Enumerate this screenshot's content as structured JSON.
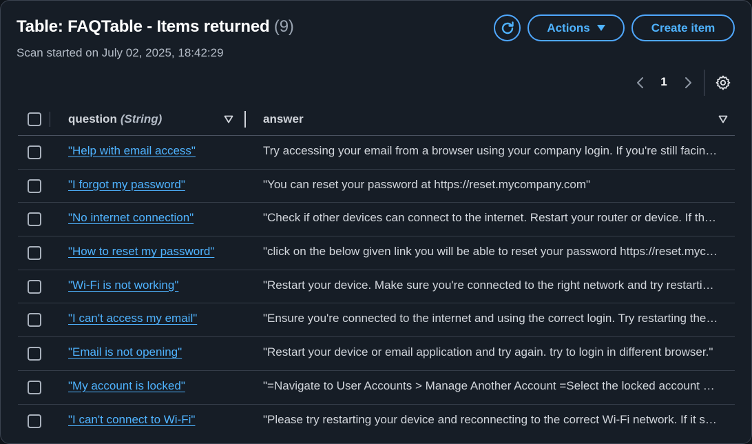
{
  "header": {
    "title_main": "Table: FAQTable - Items returned",
    "title_count": "(9)",
    "subtitle": "Scan started on July 02, 2025, 18:42:29",
    "refresh_icon": "refresh-icon",
    "actions_label": "Actions",
    "create_label": "Create item"
  },
  "pagination": {
    "current_page": "1",
    "prev_icon": "chevron-left-icon",
    "next_icon": "chevron-right-icon",
    "settings_icon": "gear-icon"
  },
  "table": {
    "columns": [
      {
        "name": "question",
        "type": "(String)"
      },
      {
        "name": "answer",
        "type": ""
      }
    ],
    "rows": [
      {
        "question": "\"Help with email access\"",
        "answer": "Try accessing your email from a browser using your company login. If you're still facing issues, contact IT support."
      },
      {
        "question": "\"I forgot my password\"",
        "answer": "\"You can reset your password at https://reset.mycompany.com\""
      },
      {
        "question": "\"No internet connection\"",
        "answer": "\"Check if other devices can connect to the internet. Restart your router or device. If the issue persists, contact IT support.\""
      },
      {
        "question": "\"How to reset my password\"",
        "answer": "\"click on the below given link you will be able to reset your password https://reset.mycompany.com\""
      },
      {
        "question": "\"Wi-Fi is not working\"",
        "answer": "\"Restart your device. Make sure you're connected to the right network and try restarting the router.\""
      },
      {
        "question": "\"I can't access my email\"",
        "answer": "\"Ensure you're connected to the internet and using the correct login. Try restarting the email application.\""
      },
      {
        "question": "\"Email is not opening\"",
        "answer": "\"Restart your device or email application and try again. try to login in different browser.\""
      },
      {
        "question": "\"My account is locked\"",
        "answer": "\"=Navigate to User Accounts > Manage Another Account =Select the locked account and unlock it.\""
      },
      {
        "question": "\"I can't connect to Wi-Fi\"",
        "answer": "\"Please try restarting your device and reconnecting to the correct Wi-Fi network. If it still fails, contact IT support.\""
      }
    ]
  },
  "colors": {
    "accent": "#4fb3ff",
    "panel_bg": "#161d26",
    "border": "#3b4350"
  }
}
